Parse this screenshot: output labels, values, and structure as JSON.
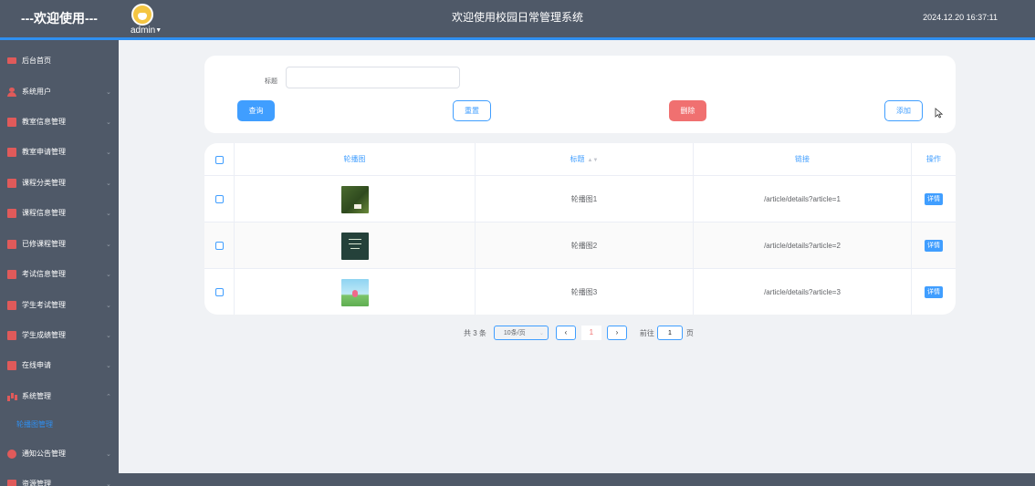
{
  "header": {
    "welcome": "---欢迎使用---",
    "username": "admin",
    "system_title": "欢迎使用校园日常管理系统",
    "datetime": "2024.12.20 16:37:11"
  },
  "sidebar": {
    "items": [
      {
        "label": "后台首页",
        "icon": "monitor-icon"
      },
      {
        "label": "系统用户",
        "icon": "user-icon"
      },
      {
        "label": "教室信息管理",
        "icon": "chart-icon"
      },
      {
        "label": "教室申请管理",
        "icon": "chart-icon"
      },
      {
        "label": "课程分类管理",
        "icon": "chart-icon"
      },
      {
        "label": "课程信息管理",
        "icon": "chart-icon"
      },
      {
        "label": "已修课程管理",
        "icon": "chart-icon"
      },
      {
        "label": "考试信息管理",
        "icon": "chart-icon"
      },
      {
        "label": "学生考试管理",
        "icon": "chart-icon"
      },
      {
        "label": "学生成绩管理",
        "icon": "chart-icon"
      },
      {
        "label": "在线申请",
        "icon": "chart-icon"
      },
      {
        "label": "系统管理",
        "icon": "bar-chart-icon"
      },
      {
        "label": "通知公告管理",
        "icon": "info-icon"
      },
      {
        "label": "资源管理",
        "icon": "chart-icon"
      }
    ],
    "active_sub": "轮播图管理"
  },
  "search": {
    "title_label": "标题",
    "title_value": "",
    "query_label": "查询",
    "reset_label": "重置",
    "delete_label": "删除",
    "add_label": "添加"
  },
  "table": {
    "headers": {
      "image": "轮播图",
      "title": "标题",
      "link": "链接",
      "action": "操作"
    },
    "rows": [
      {
        "title": "轮播图1",
        "link": "/article/details?article=1",
        "action": "详情"
      },
      {
        "title": "轮播图2",
        "link": "/article/details?article=2",
        "action": "详情"
      },
      {
        "title": "轮播图3",
        "link": "/article/details?article=3",
        "action": "详情"
      }
    ]
  },
  "pagination": {
    "total": "共 3 条",
    "page_size": "10条/页",
    "current_page": "1",
    "goto_label": "前往",
    "goto_value": "1",
    "page_suffix": "页"
  },
  "colors": {
    "primary": "#409eff",
    "danger": "#f07070",
    "sidebar_bg": "#4f5968",
    "accent_line": "#2f8ff0"
  }
}
